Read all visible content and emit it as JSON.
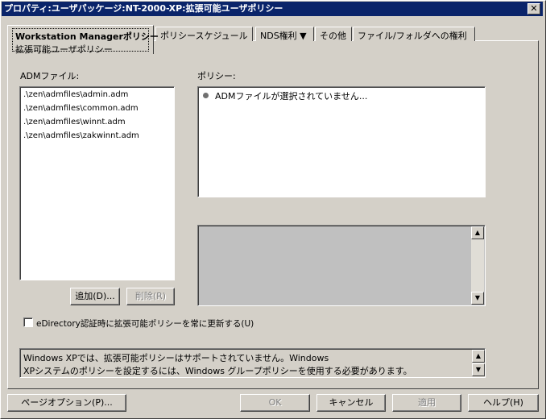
{
  "window": {
    "title": "プロパティ:ユーザパッケージ:NT-2000-XP:拡張可能ユーザポリシー",
    "close": "✕"
  },
  "tabs": [
    {
      "label": "Workstation Managerポリシー",
      "sub": "拡張可能ユーザポリシー"
    },
    {
      "label": "ポリシースケジュール"
    },
    {
      "label": "NDS権利 ▼"
    },
    {
      "label": "その他"
    },
    {
      "label": "ファイル/フォルダへの権利"
    }
  ],
  "adm": {
    "label": "ADMファイル:",
    "files": [
      ".\\zen\\admfiles\\admin.adm",
      ".\\zen\\admfiles\\common.adm",
      ".\\zen\\admfiles\\winnt.adm",
      ".\\zen\\admfiles\\zakwinnt.adm"
    ],
    "add": "追加(D)...",
    "remove": "削除(R)"
  },
  "policy": {
    "label": "ポリシー:",
    "item": "ADMファイルが選択されていません..."
  },
  "checkbox": {
    "label": "eDirectory認証時に拡張可能ポリシーを常に更新する(U)",
    "checked": false
  },
  "info": {
    "line1": "Windows XPでは、拡張可能ポリシーはサポートされていません。Windows",
    "line2": "XPシステムのポリシーを設定するには、Windows グループポリシーを使用する必要があります。"
  },
  "buttons": {
    "page_options": "ページオプション(P)...",
    "ok": "OK",
    "cancel": "キャンセル",
    "apply": "適用",
    "help": "ヘルプ(H)"
  },
  "scroll": {
    "up": "▲",
    "down": "▼"
  }
}
